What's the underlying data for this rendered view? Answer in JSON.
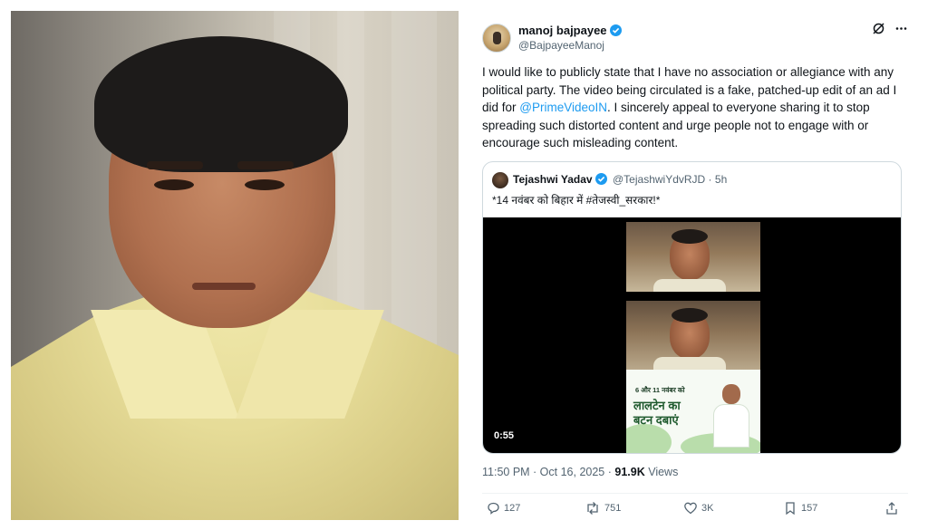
{
  "tweet": {
    "author_name": "manoj bajpayee",
    "handle": "@BajpayeeManoj",
    "verified": true,
    "body_parts": [
      "I would like to publicly state that I have no association or allegiance with any political party. The video being circulated is a fake, patched-up edit of an ad I did for ",
      "@PrimeVideoIN",
      ". I sincerely appeal to everyone sharing it to stop spreading such distorted content and urge people not to engage with or encourage such misleading content."
    ],
    "timestamp": "11:50 PM · Oct 16, 2025 · ",
    "views_count": "91.9K",
    "views_label": " Views",
    "actions": {
      "replies": "127",
      "reposts": "751",
      "likes": "3K",
      "bookmarks": "157"
    },
    "icons": {
      "grok": "grok-icon",
      "more": "more-icon"
    }
  },
  "quote": {
    "author_name": "Tejashwi Yadav",
    "handle": "@TejashwiYdvRJD",
    "time": "5h",
    "meta_separator": " · ",
    "text": "*14 नवंबर को बिहार में #तेजस्वी_सरकार!*",
    "video_duration": "0:55",
    "poster_small_text": "6 और 11 नवंबर को",
    "poster_line1": "लालटेन का",
    "poster_line2": "बटन दबाएं"
  },
  "colors": {
    "accent": "#1d9bf0",
    "text": "#0f1419",
    "secondary": "#536471",
    "border": "#cfd9de"
  }
}
